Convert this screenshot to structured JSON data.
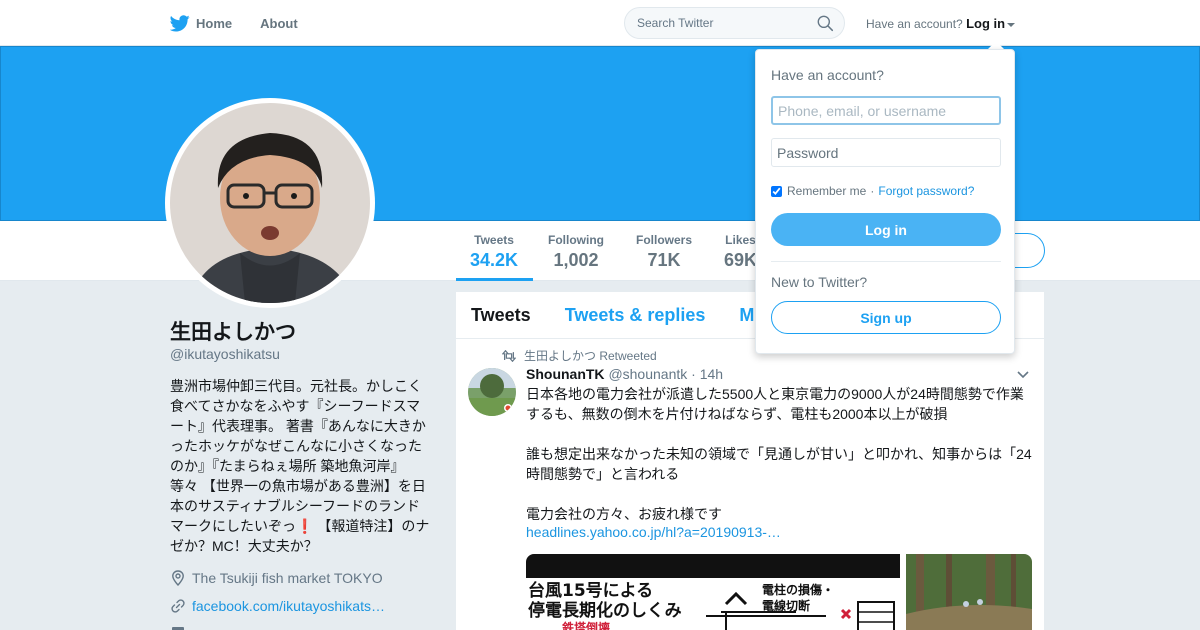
{
  "nav": {
    "home_label": "Home",
    "about_label": "About",
    "search_placeholder": "Search Twitter",
    "account_prompt": "Have an account?",
    "login_label": "Log in",
    "icons": {
      "logo": "twitter-bird-icon",
      "search": "search-icon",
      "caret": "caret-down-icon"
    }
  },
  "profile": {
    "name": "生田よしかつ",
    "handle": "@ikutayoshikatsu",
    "bio_before": "豊洲市場仲卸三代目。元社長。かしこく食べてさかなをふやす『シーフードスマート』代表理事。 著書『あんなに大きかったホッケがなぜこんなに小さくなったのか』『たまらねぇ場所 築地魚河岸』等々 【世界一の魚市場がある豊洲】を日本のサスティナブルシーフードのランドマークにしたいぞっ",
    "bio_mark": "❗",
    "bio_after": " 【報道特注】のナゼか？MC！大丈夫か？",
    "location": "The Tsukiji fish market TOKYO",
    "website": "facebook.com/ikutayoshikats…"
  },
  "stats": [
    {
      "label": "Tweets",
      "value": "34.2K"
    },
    {
      "label": "Following",
      "value": "1,002"
    },
    {
      "label": "Followers",
      "value": "71K"
    },
    {
      "label": "Likes",
      "value": "69K"
    }
  ],
  "timeline": {
    "tabs": [
      "Tweets",
      "Tweets & replies",
      "M"
    ],
    "retweet_note": "生田よしかつ Retweeted",
    "tweet": {
      "name": "ShounanTK",
      "handle": "@shounantk",
      "time": "· 14h",
      "para1": "日本各地の電力会社が派遣した5500人と東京電力の9000人が24時間態勢で作業するも、無数の倒木を片付けねばならず、電柱も2000本以上が破損",
      "para2": "誰も想定出来なかった未知の領域で「見通しが甘い」と叩かれ、知事からは「24時間態勢で」と言われる",
      "para3": "電力会社の方々、お疲れ様です",
      "link": "headlines.yahoo.co.jp/hl?a=20190913-…",
      "media_title_1": "台風15号による",
      "media_title_2": "停電長期化のしくみ",
      "media_label_1": "電柱の損傷・",
      "media_label_2": "電線切断",
      "media_label_3": "鉄塔倒壊"
    }
  },
  "login_dropdown": {
    "heading": "Have an account?",
    "username_placeholder": "Phone, email, or username",
    "password_placeholder": "Password",
    "remember_label": "Remember me",
    "separator": "·",
    "forgot_label": "Forgot password?",
    "login_button": "Log in",
    "new_prompt": "New to Twitter?",
    "signup_button": "Sign up"
  },
  "colors": {
    "brand_blue": "#1da1f2",
    "link_blue": "#1b95e0",
    "page_bg": "#e6ecf0"
  }
}
